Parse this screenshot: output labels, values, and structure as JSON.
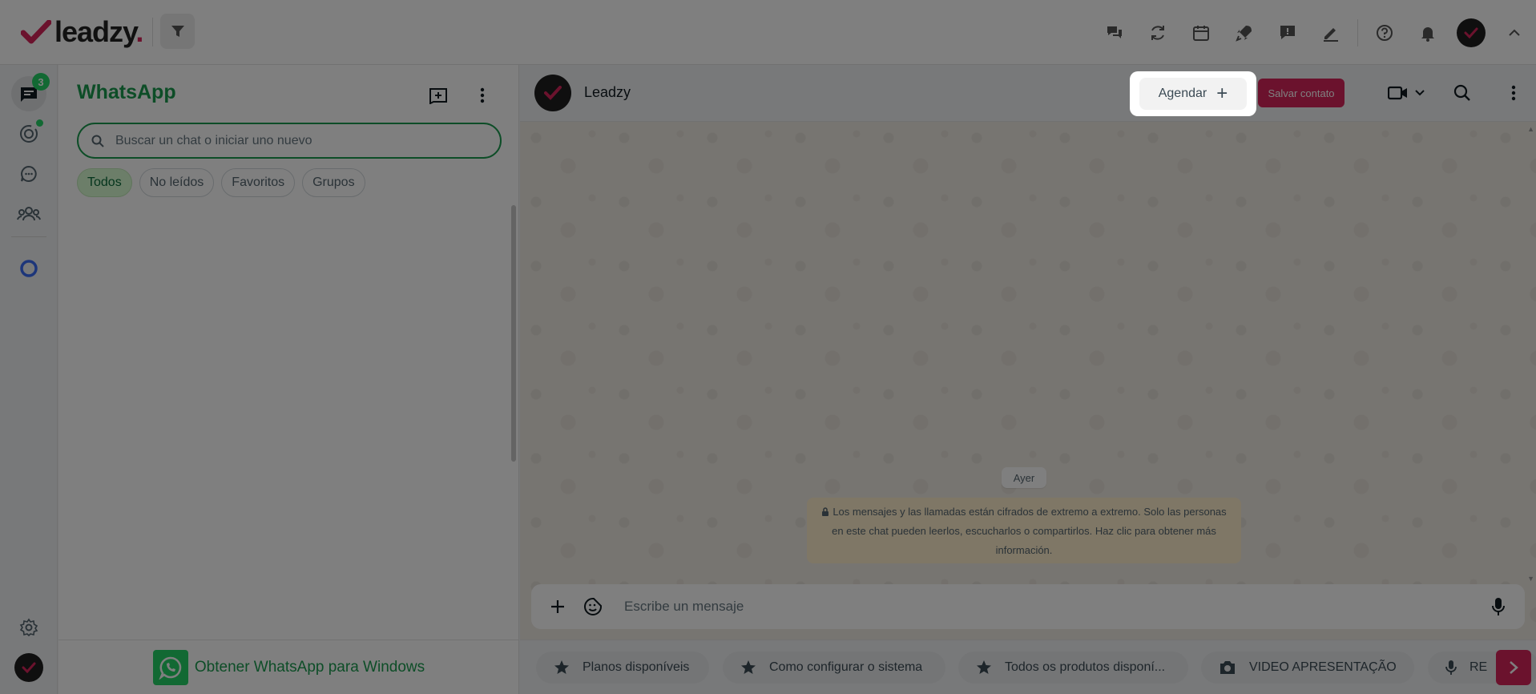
{
  "brand": {
    "name": "leadzy",
    "dot": ".",
    "accent": "#d6245a",
    "green": "#1a9b4f"
  },
  "topbar": {
    "icons": [
      "chat-bubbles-icon",
      "sync-icon",
      "calendar-icon",
      "rocket-icon",
      "message-alert-icon",
      "pen-icon",
      "help-icon",
      "bell-icon",
      "avatar",
      "chevron-up-icon"
    ]
  },
  "rail": {
    "chats_badge": "3"
  },
  "chatlist": {
    "title": "WhatsApp",
    "search_placeholder": "Buscar un chat o iniciar uno nuevo",
    "filters": [
      {
        "label": "Todos",
        "active": true
      },
      {
        "label": "No leídos",
        "active": false
      },
      {
        "label": "Favoritos",
        "active": false
      },
      {
        "label": "Grupos",
        "active": false
      }
    ],
    "footer_text": "Obtener WhatsApp para Windows"
  },
  "conversation": {
    "contact_name": "Leadzy",
    "agendar_label": "Agendar",
    "salvar_label": "Salvar contato",
    "day_label": "Ayer",
    "encryption_note": "Los mensajes y las llamadas están cifrados de extremo a extremo. Solo las personas en este chat pueden leerlos, escucharlos o compartirlos. Haz clic para obtener más información.",
    "composer_placeholder": "Escribe un mensaje"
  },
  "quick_replies": [
    {
      "icon": "star-icon",
      "label": "Planos disponíveis"
    },
    {
      "icon": "star-icon",
      "label": "Como configurar o sistema"
    },
    {
      "icon": "star-icon",
      "label": "Todos os produtos disponí..."
    },
    {
      "icon": "camera-icon",
      "label": "VIDEO APRESENTAÇÃO"
    },
    {
      "icon": "mic-icon",
      "label": "RE"
    }
  ]
}
